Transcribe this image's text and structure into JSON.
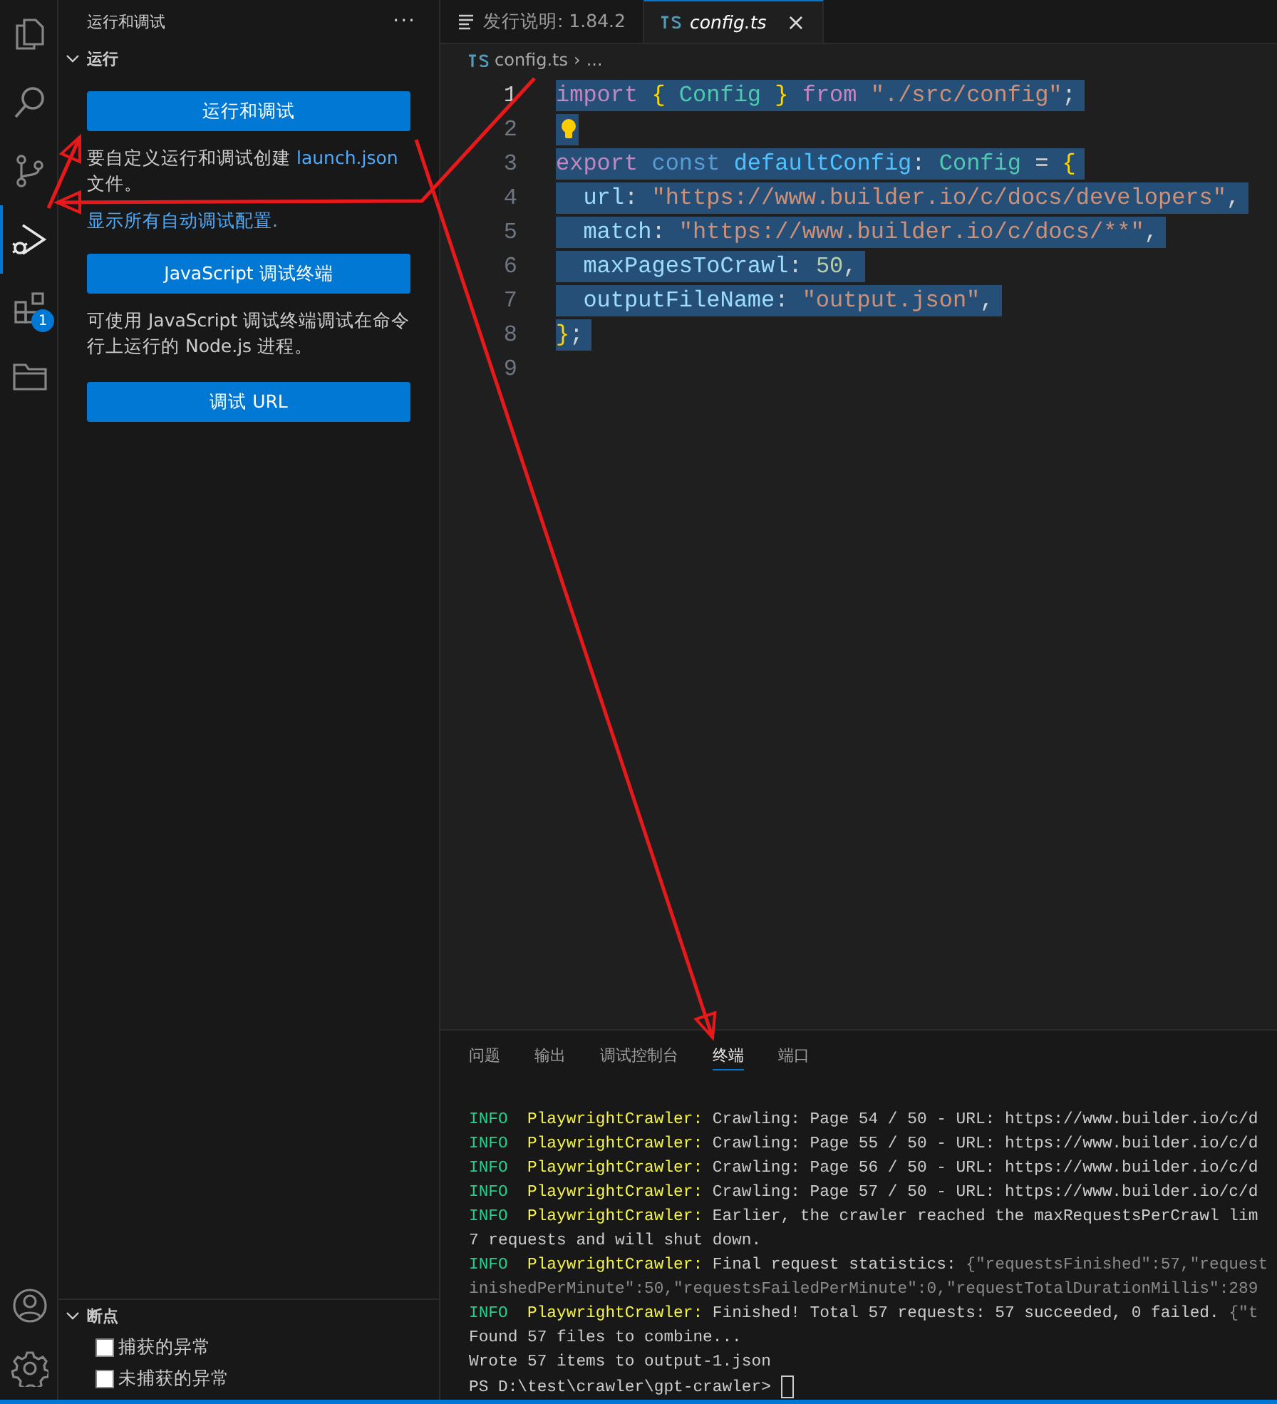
{
  "activity_bar": {
    "items": [
      {
        "kind": "files",
        "selected": false
      },
      {
        "kind": "search",
        "selected": false
      },
      {
        "kind": "source-control",
        "selected": false
      },
      {
        "kind": "run-debug",
        "selected": true
      },
      {
        "kind": "extensions",
        "selected": false,
        "badge": "1"
      },
      {
        "kind": "folder",
        "selected": false
      }
    ],
    "bottom_items": [
      {
        "kind": "account"
      },
      {
        "kind": "settings"
      }
    ]
  },
  "sidebar": {
    "title": "运行和调试",
    "more": "···",
    "run_section": {
      "title": "运行",
      "expanded": true,
      "blocks": [
        {
          "kind": "button",
          "label": "运行和调试"
        },
        {
          "kind": "text",
          "text": "要自定义运行和调试创建 ",
          "link": "launch.json",
          "after": " 文件。"
        },
        {
          "kind": "link",
          "text": "显示所有自动调试配置."
        },
        {
          "kind": "button",
          "label": "JavaScript 调试终端"
        },
        {
          "kind": "text",
          "text": "可使用 JavaScript 调试终端调试在命令行上运行的 Node.js 进程。"
        },
        {
          "kind": "button",
          "label": "调试 URL"
        }
      ]
    },
    "breakpoints": {
      "title": "断点",
      "expanded": true,
      "items": [
        {
          "label": "捕获的异常",
          "checked": false
        },
        {
          "label": "未捕获的异常",
          "checked": false
        }
      ]
    }
  },
  "editor": {
    "tabs": [
      {
        "kind": "preview",
        "label": "发行说明: 1.84.2",
        "selected": false
      },
      {
        "kind": "ts",
        "label": "config.ts",
        "selected": true,
        "close": "×"
      }
    ],
    "breadcrumb": {
      "file": "config.ts",
      "separator": "›",
      "rest": "..."
    },
    "lines": [
      {
        "number": "1",
        "current": true,
        "selected": true,
        "tokens": [
          {
            "text": "import ",
            "color": "#c586c0"
          },
          {
            "text": "{ ",
            "color": "#ffd700"
          },
          {
            "text": "Config ",
            "color": "#4ec9b0"
          },
          {
            "text": "} ",
            "color": "#ffd700"
          },
          {
            "text": "from ",
            "color": "#c586c0"
          },
          {
            "text": "\"./src/config\"",
            "color": "#ce9178"
          },
          {
            "text": ";",
            "color": "#d4d4d4"
          }
        ]
      },
      {
        "number": "2",
        "current": false,
        "selected": true,
        "lightbulb": true
      },
      {
        "number": "3",
        "current": false,
        "selected": true,
        "tokens": [
          {
            "text": "export ",
            "color": "#c586c0"
          },
          {
            "text": "const ",
            "color": "#569cd6"
          },
          {
            "text": "defaultConfig",
            "color": "#4fc1ff"
          },
          {
            "text": ": ",
            "color": "#d4d4d4"
          },
          {
            "text": "Config ",
            "color": "#4ec9b0"
          },
          {
            "text": "= ",
            "color": "#d4d4d4"
          },
          {
            "text": "{",
            "color": "#ffd700"
          }
        ]
      },
      {
        "number": "4",
        "current": false,
        "selected": true,
        "tokens": [
          {
            "text": "  url",
            "color": "#9cdcfe"
          },
          {
            "text": ": ",
            "color": "#d4d4d4"
          },
          {
            "text": "\"https://www.builder.io/c/docs/developers\"",
            "color": "#ce9178"
          },
          {
            "text": ",",
            "color": "#d4d4d4"
          }
        ]
      },
      {
        "number": "5",
        "current": false,
        "selected": true,
        "tokens": [
          {
            "text": "  match",
            "color": "#9cdcfe"
          },
          {
            "text": ": ",
            "color": "#d4d4d4"
          },
          {
            "text": "\"https://www.builder.io/c/docs/**\"",
            "color": "#ce9178"
          },
          {
            "text": ",",
            "color": "#d4d4d4"
          }
        ]
      },
      {
        "number": "6",
        "current": false,
        "selected": true,
        "tokens": [
          {
            "text": "  maxPagesToCrawl",
            "color": "#9cdcfe"
          },
          {
            "text": ": ",
            "color": "#d4d4d4"
          },
          {
            "text": "50",
            "color": "#b5cea8"
          },
          {
            "text": ",",
            "color": "#d4d4d4"
          }
        ]
      },
      {
        "number": "7",
        "current": false,
        "selected": true,
        "tokens": [
          {
            "text": "  outputFileName",
            "color": "#9cdcfe"
          },
          {
            "text": ": ",
            "color": "#d4d4d4"
          },
          {
            "text": "\"output.json\"",
            "color": "#ce9178"
          },
          {
            "text": ",",
            "color": "#d4d4d4"
          }
        ]
      },
      {
        "number": "8",
        "current": false,
        "selected": true,
        "tokens": [
          {
            "text": "}",
            "color": "#ffd700"
          },
          {
            "text": ";",
            "color": "#d4d4d4"
          }
        ]
      },
      {
        "number": "9",
        "current": false,
        "selected": false
      }
    ]
  },
  "panel": {
    "tabs": [
      {
        "label": "问题",
        "selected": false
      },
      {
        "label": "输出",
        "selected": false
      },
      {
        "label": "调试控制台",
        "selected": false
      },
      {
        "label": "终端",
        "selected": true
      },
      {
        "label": "端口",
        "selected": false
      }
    ],
    "terminal_lines": [
      [
        {
          "text": "INFO  ",
          "color": "#23d18b"
        },
        {
          "text": "PlaywrightCrawler:",
          "color": "#f5f543"
        },
        {
          "text": " Crawling: Page 54 / 50 - URL: https://www.builder.io/c/d",
          "color": "#cccccc"
        }
      ],
      [
        {
          "text": "INFO  ",
          "color": "#23d18b"
        },
        {
          "text": "PlaywrightCrawler:",
          "color": "#f5f543"
        },
        {
          "text": " Crawling: Page 55 / 50 - URL: https://www.builder.io/c/d",
          "color": "#cccccc"
        }
      ],
      [
        {
          "text": "INFO  ",
          "color": "#23d18b"
        },
        {
          "text": "PlaywrightCrawler:",
          "color": "#f5f543"
        },
        {
          "text": " Crawling: Page 56 / 50 - URL: https://www.builder.io/c/d",
          "color": "#cccccc"
        }
      ],
      [
        {
          "text": "INFO  ",
          "color": "#23d18b"
        },
        {
          "text": "PlaywrightCrawler:",
          "color": "#f5f543"
        },
        {
          "text": " Crawling: Page 57 / 50 - URL: https://www.builder.io/c/d",
          "color": "#cccccc"
        }
      ],
      [
        {
          "text": "INFO  ",
          "color": "#23d18b"
        },
        {
          "text": "PlaywrightCrawler:",
          "color": "#f5f543"
        },
        {
          "text": " Earlier, the crawler reached the maxRequestsPerCrawl lim",
          "color": "#cccccc"
        }
      ],
      [
        {
          "text": "7 requests and will shut down.",
          "color": "#cccccc"
        }
      ],
      [
        {
          "text": "INFO  ",
          "color": "#23d18b"
        },
        {
          "text": "PlaywrightCrawler:",
          "color": "#f5f543"
        },
        {
          "text": " Final request statistics: ",
          "color": "#cccccc"
        },
        {
          "text": "{\"requestsFinished\":57,\"request",
          "color": "#8a8a8a"
        }
      ],
      [
        {
          "text": "inishedPerMinute\":50,\"requestsFailedPerMinute\":0,\"requestTotalDurationMillis\":289",
          "color": "#8a8a8a"
        }
      ],
      [
        {
          "text": "INFO  ",
          "color": "#23d18b"
        },
        {
          "text": "PlaywrightCrawler:",
          "color": "#f5f543"
        },
        {
          "text": " Finished! Total 57 requests: 57 succeeded, 0 failed. ",
          "color": "#cccccc"
        },
        {
          "text": "{\"t",
          "color": "#8a8a8a"
        }
      ],
      [
        {
          "text": "Found 57 files to combine...",
          "color": "#cccccc"
        }
      ],
      [
        {
          "text": "Wrote 57 items to output-1.json",
          "color": "#cccccc"
        }
      ],
      [
        {
          "text": "PS D:\\test\\crawler\\gpt-crawler> ",
          "color": "#cccccc"
        }
      ]
    ],
    "cursor": true
  }
}
